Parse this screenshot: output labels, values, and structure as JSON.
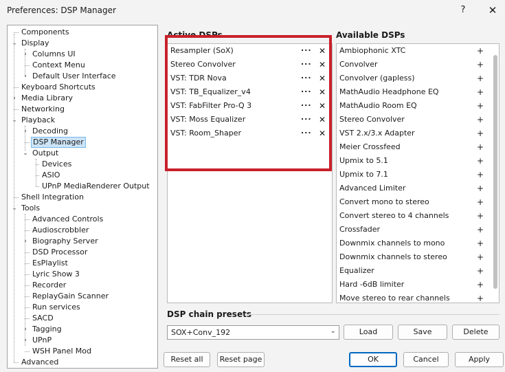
{
  "window": {
    "title": "Preferences: DSP Manager",
    "help_glyph": "?",
    "close_glyph": "✕"
  },
  "tree": [
    {
      "label": "Components"
    },
    {
      "label": "Display",
      "exp": "⌄"
    },
    {
      "label": "Columns UI",
      "exp": "›"
    },
    {
      "label": "Context Menu"
    },
    {
      "label": "Default User Interface",
      "exp": "›"
    },
    {
      "label": "Keyboard Shortcuts"
    },
    {
      "label": "Media Library",
      "exp": "›"
    },
    {
      "label": "Networking"
    },
    {
      "label": "Playback",
      "exp": "⌄"
    },
    {
      "label": "Decoding",
      "exp": "›"
    },
    {
      "label": "DSP Manager",
      "selected": true
    },
    {
      "label": "Output",
      "exp": "⌄"
    },
    {
      "label": "Devices"
    },
    {
      "label": "ASIO"
    },
    {
      "label": "UPnP MediaRenderer Output"
    },
    {
      "label": "Shell Integration"
    },
    {
      "label": "Tools",
      "exp": "⌄"
    },
    {
      "label": "Advanced Controls"
    },
    {
      "label": "Audioscrobbler"
    },
    {
      "label": "Biography Server",
      "exp": "›"
    },
    {
      "label": "DSD Processor"
    },
    {
      "label": "EsPlaylist"
    },
    {
      "label": "Lyric Show 3"
    },
    {
      "label": "Recorder"
    },
    {
      "label": "ReplayGain Scanner"
    },
    {
      "label": "Run services"
    },
    {
      "label": "SACD"
    },
    {
      "label": "Tagging",
      "exp": "›"
    },
    {
      "label": "UPnP",
      "exp": "›"
    },
    {
      "label": "WSH Panel Mod"
    },
    {
      "label": "Advanced"
    }
  ],
  "active": {
    "heading": "Active DSPs",
    "more_glyph": "...",
    "remove_glyph": "✕",
    "items": [
      "Resampler (SoX)",
      "Stereo Convolver",
      "VST: TDR Nova",
      "VST: TB_Equalizer_v4",
      "VST: FabFilter Pro-Q 3",
      "VST: Moss Equalizer",
      "VST: Room_Shaper"
    ]
  },
  "available": {
    "heading": "Available DSPs",
    "add_glyph": "+",
    "items": [
      "Ambiophonic XTC",
      "Convolver",
      "Convolver (gapless)",
      "MathAudio Headphone EQ",
      "MathAudio Room EQ",
      "Stereo Convolver",
      "VST 2.x/3.x Adapter",
      "Meier Crossfeed",
      "Upmix to 5.1",
      "Upmix to 7.1",
      "Advanced Limiter",
      "Convert mono to stereo",
      "Convert stereo to 4 channels",
      "Crossfader",
      "Downmix channels to mono",
      "Downmix channels to stereo",
      "Equalizer",
      "Hard -6dB limiter",
      "Move stereo to rear channels"
    ]
  },
  "presets": {
    "heading": "DSP chain presets",
    "selected": "SOX+Conv_192",
    "arrow_glyph": "⌄",
    "load": "Load",
    "save": "Save",
    "delete": "Delete"
  },
  "footer": {
    "reset_all": "Reset all",
    "reset_page": "Reset page",
    "ok": "OK",
    "cancel": "Cancel",
    "apply": "Apply"
  },
  "colors": {
    "highlight_box": "#c8202a",
    "selection": "#cce4f7",
    "accent": "#0067c0"
  }
}
